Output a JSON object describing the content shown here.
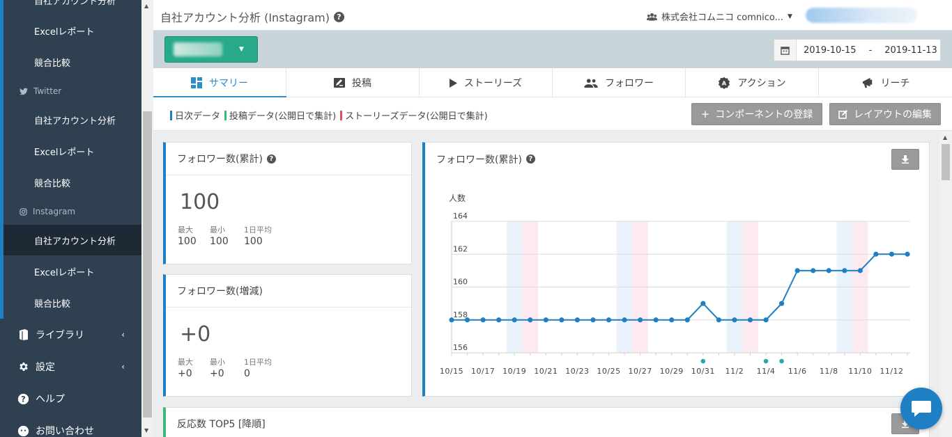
{
  "sidebar": {
    "top_partial": "自社アカウント分析",
    "twitter_section": "Twitter",
    "instagram_section": "Instagram",
    "items_top": [
      "Excelレポート",
      "競合比較"
    ],
    "twitter_items": [
      "自社アカウント分析",
      "Excelレポート",
      "競合比較"
    ],
    "instagram_items": [
      "自社アカウント分析",
      "Excelレポート",
      "競合比較"
    ],
    "library": "ライブラリ",
    "settings": "設定",
    "help": "ヘルプ",
    "contact": "お問い合わせ"
  },
  "header": {
    "title": "自社アカウント分析 (Instagram)",
    "company": "株式会社コムニコ comnico..."
  },
  "band": {
    "date_from": "2019-10-15",
    "date_sep": "-",
    "date_to": "2019-11-13"
  },
  "tabs": [
    "サマリー",
    "投稿",
    "ストーリーズ",
    "フォロワー",
    "アクション",
    "リーチ"
  ],
  "legend": {
    "daily": "日次データ",
    "posts": "投稿データ(公開日で集計)",
    "stories": "ストーリーズデータ(公開日で集計)",
    "colors": {
      "daily": "#1f7fc4",
      "posts": "#3cb878",
      "stories": "#e04f5f"
    }
  },
  "toolbar": {
    "add_component": "コンポーネントの登録",
    "edit_layout": "レイアウトの編集"
  },
  "card_total": {
    "title": "フォロワー数(累計)",
    "value": "100",
    "max_label": "最大",
    "max": "100",
    "min_label": "最小",
    "min": "100",
    "avg_label": "1日平均",
    "avg": "100"
  },
  "card_change": {
    "title": "フォロワー数(増減)",
    "value": "+0",
    "max_label": "最大",
    "max": "+0",
    "min_label": "最小",
    "min": "+0",
    "avg_label": "1日平均",
    "avg": "0"
  },
  "card_chart": {
    "title": "フォロワー数(累計)"
  },
  "card_top5": {
    "title": "反応数 TOP5 [降順]"
  },
  "chart_data": {
    "type": "line",
    "ylabel": "人数",
    "ylim": [
      156,
      164
    ],
    "yticks": [
      156,
      158,
      160,
      162,
      164
    ],
    "x": [
      "10/15",
      "10/16",
      "10/17",
      "10/18",
      "10/19",
      "10/20",
      "10/21",
      "10/22",
      "10/23",
      "10/24",
      "10/25",
      "10/26",
      "10/27",
      "10/28",
      "10/29",
      "10/30",
      "10/31",
      "11/1",
      "11/2",
      "11/3",
      "11/4",
      "11/5",
      "11/6",
      "11/7",
      "11/8",
      "11/9",
      "11/10",
      "11/11",
      "11/12",
      "11/13"
    ],
    "xtick_labels": [
      "10/15",
      "10/17",
      "10/19",
      "10/21",
      "10/23",
      "10/25",
      "10/27",
      "10/29",
      "10/31",
      "11/2",
      "11/4",
      "11/6",
      "11/8",
      "11/10",
      "11/12"
    ],
    "values": [
      158,
      158,
      158,
      158,
      158,
      158,
      158,
      158,
      158,
      158,
      158,
      158,
      158,
      158,
      158,
      158,
      159,
      158,
      158,
      158,
      158,
      159,
      161,
      161,
      161,
      161,
      161,
      162,
      162,
      162
    ],
    "post_markers": [
      "10/31",
      "11/4",
      "11/5"
    ],
    "weekend_bands": [
      [
        "10/19",
        "10/20"
      ],
      [
        "10/26",
        "10/27"
      ],
      [
        "11/2",
        "11/3"
      ],
      [
        "11/9",
        "11/10"
      ]
    ],
    "line_color": "#1f7fc4",
    "marker_color": "#2aa8a8",
    "grid": true
  }
}
